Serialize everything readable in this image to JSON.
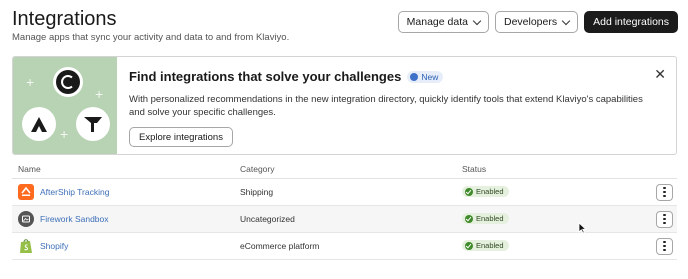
{
  "header": {
    "title": "Integrations",
    "subtitle": "Manage apps that sync your activity and data to and from Klaviyo."
  },
  "actions": {
    "manage_data_label": "Manage data",
    "developers_label": "Developers",
    "add_integrations_label": "Add integrations"
  },
  "banner": {
    "title": "Find integrations that solve your challenges",
    "badge_label": "New",
    "text": "With personalized recommendations in the new integration directory, quickly identify tools that extend Klaviyo's capabilities and solve your specific challenges.",
    "button_label": "Explore integrations",
    "close_icon": "close-icon"
  },
  "table": {
    "columns": [
      "Name",
      "Category",
      "Status"
    ],
    "rows": [
      {
        "name": "AfterShip Tracking",
        "category": "Shipping",
        "status": "Enabled",
        "icon": "aftership-icon"
      },
      {
        "name": "Firework Sandbox",
        "category": "Uncategorized",
        "status": "Enabled",
        "icon": "firework-icon"
      },
      {
        "name": "Shopify",
        "category": "eCommerce platform",
        "status": "Enabled",
        "icon": "shopify-icon"
      }
    ]
  },
  "colors": {
    "primary_button": "#1b1b1b",
    "banner_art": "#b8d2b4",
    "link": "#3d6fb7",
    "status_enabled": "#3f8a2a"
  }
}
